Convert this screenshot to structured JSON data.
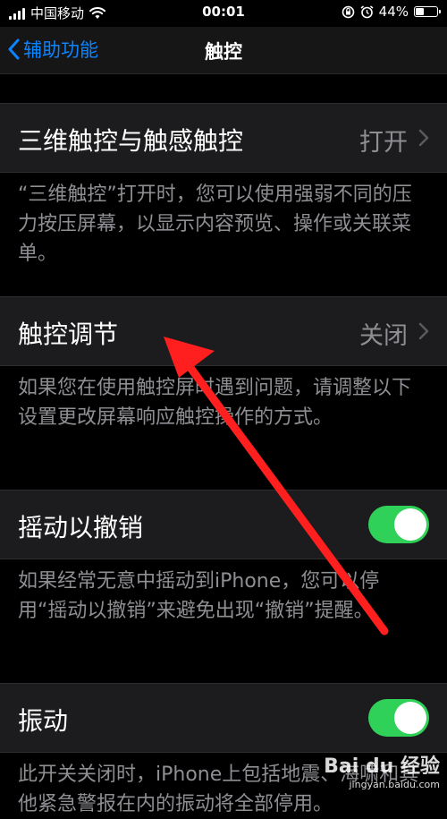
{
  "status_bar": {
    "carrier": "中国移动",
    "time": "00:01",
    "battery": "44%",
    "battery_level": 0.44
  },
  "nav": {
    "back_label": "辅助功能",
    "title": "触控"
  },
  "sections": [
    {
      "label": "三维触控与触感触控",
      "value": "打开",
      "control": "disclosure",
      "footer": "“三维触控”打开时，您可以使用强弱不同的压力按压屏幕，以显示内容预览、操作或关联菜单。"
    },
    {
      "label": "触控调节",
      "value": "关闭",
      "control": "disclosure",
      "footer": "如果您在使用触控屏时遇到问题，请调整以下设置更改屏幕响应触控操作的方式。"
    },
    {
      "label": "摇动以撤销",
      "control": "toggle",
      "toggle_on": true,
      "footer": "如果经常无意中摇动到iPhone，您可以停用“摇动以撤销”来避免出现“撤销”提醒。"
    },
    {
      "label": "振动",
      "control": "toggle",
      "toggle_on": true,
      "footer": "此开关关闭时，iPhone上包括地震、海啸和其他紧急警报在内的振动将全部停用。"
    }
  ],
  "watermark": {
    "main": "Bai du 经验",
    "sub": "jingyan.baidu.com"
  },
  "colors": {
    "accent": "#0a84ff",
    "toggle_on": "#30d158",
    "annotation_arrow": "#ff1f1f"
  }
}
